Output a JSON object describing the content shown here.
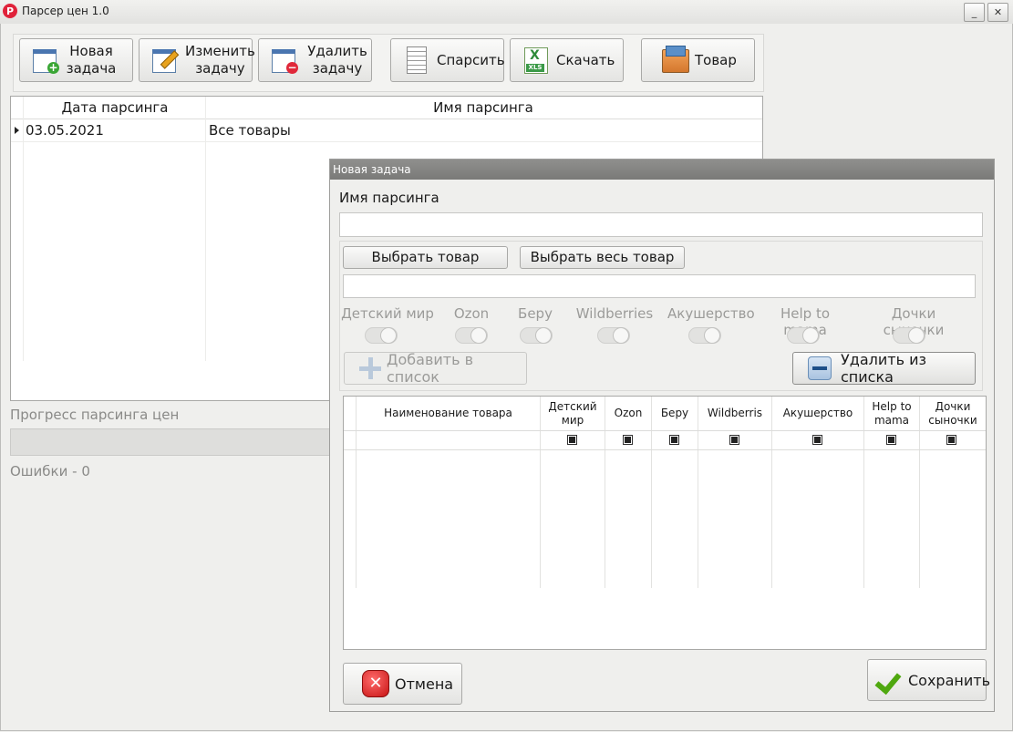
{
  "window": {
    "title": "Парсер цен 1.0",
    "logo_letter": "P",
    "minimize_glyph": "_",
    "close_glyph": "✕",
    "accent_color": "#e0223a"
  },
  "toolbar": {
    "new_task": "Новая задача",
    "edit_task": "Изменить задачу",
    "delete_task": "Удалить задачу",
    "parse": "Спарсить",
    "download": "Скачать",
    "goods": "Товар",
    "xls_badge": "XLS",
    "xls_letter": "X"
  },
  "tasks_grid": {
    "columns": [
      "Дата парсинга",
      "Имя парсинга"
    ],
    "rows": [
      {
        "date": "03.05.2021",
        "name": "Все товары"
      }
    ]
  },
  "progress": {
    "label": "Прогресс парсинга цен",
    "value": 0,
    "errors_label": "Ошибки -",
    "errors_count": "0"
  },
  "dialog": {
    "title": "Новая задача",
    "name_label": "Имя парсинга",
    "name_value": "",
    "select_goods": "Выбрать товар",
    "select_all_goods": "Выбрать весь товар",
    "selected_goods_value": "",
    "shops": [
      "Детский мир",
      "Ozon",
      "Беру",
      "Wildberries",
      "Акушерство",
      "Help to mama",
      "Дочки сыночки"
    ],
    "add_to_list": "Добавить в список",
    "remove_from_list": "Удалить из списка",
    "table_columns": [
      "Наименование товара",
      "Детский мир",
      "Ozon",
      "Беру",
      "Wildberris",
      "Акушерство",
      "Help to mama",
      "Дочки сыночки"
    ],
    "cancel": "Отмена",
    "save": "Сохранить"
  }
}
